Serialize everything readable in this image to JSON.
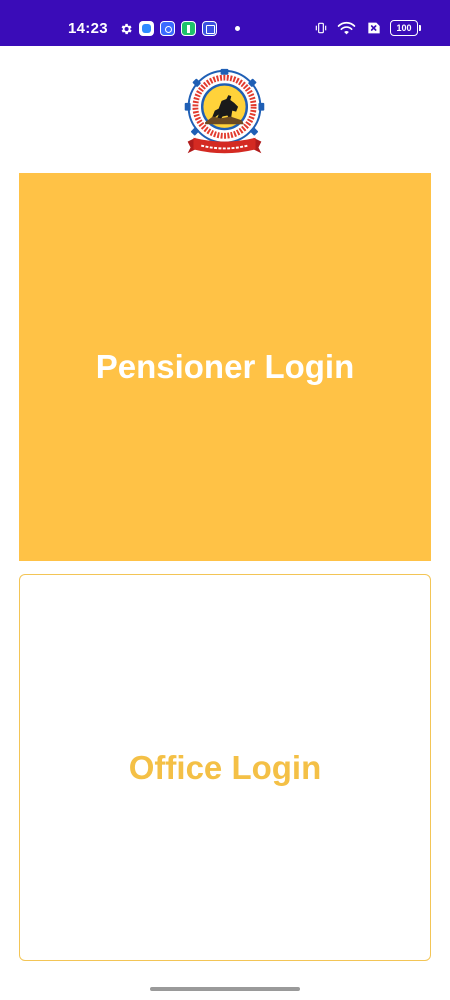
{
  "status_bar": {
    "time": "14:23",
    "battery": "100",
    "background": "#3a0cb8",
    "icons": [
      "gear-icon",
      "blue-app-icon",
      "broadcast-app-icon",
      "green-upload-app-icon",
      "gallery-app-icon",
      "notification-dot",
      "vibrate-icon",
      "wifi-icon",
      "sim-x-icon",
      "battery-icon"
    ]
  },
  "logo": {
    "arc_text": "पिंपरी चिंचवड महानगरपालिका पिंपरी ४११ ०१८",
    "ribbon_text": "कर्तव्यदक्ष नागरिकत्व"
  },
  "buttons": {
    "pensioner_label": "Pensioner Login",
    "office_label": "Office Login"
  },
  "colors": {
    "accent": "#ffc246",
    "office_text": "#f4c046",
    "office_border": "#f3c556"
  }
}
